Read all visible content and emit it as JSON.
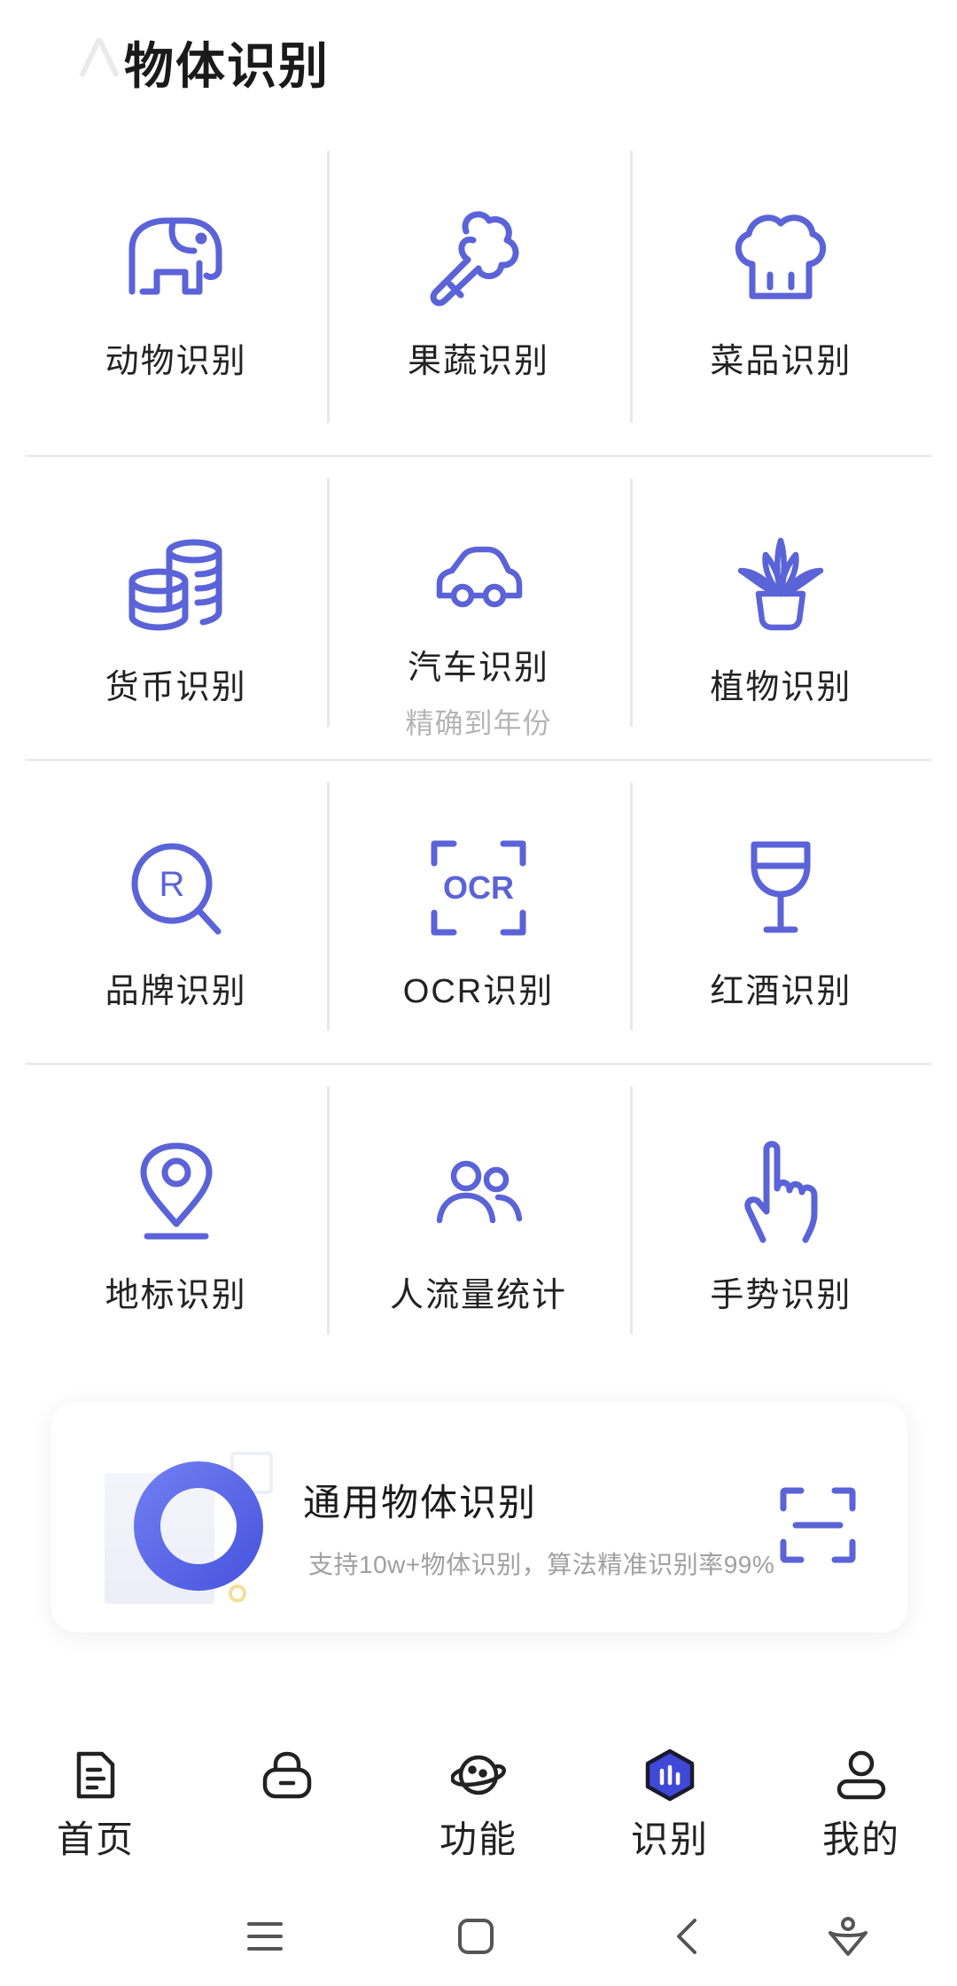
{
  "header": {
    "title": "物体识别"
  },
  "grid": {
    "rows": [
      [
        {
          "label": "动物识别",
          "icon": "elephant-icon"
        },
        {
          "label": "果蔬识别",
          "icon": "vegetable-icon"
        },
        {
          "label": "菜品识别",
          "icon": "chef-hat-icon"
        }
      ],
      [
        {
          "label": "货币识别",
          "icon": "coins-icon"
        },
        {
          "label": "汽车识别",
          "sub": "精确到年份",
          "icon": "car-icon"
        },
        {
          "label": "植物识别",
          "icon": "potted-plant-icon"
        }
      ],
      [
        {
          "label": "品牌识别",
          "icon": "brand-search-icon"
        },
        {
          "label": "OCR识别",
          "icon": "ocr-icon"
        },
        {
          "label": "红酒识别",
          "icon": "wine-glass-icon"
        }
      ],
      [
        {
          "label": "地标识别",
          "icon": "map-pin-icon"
        },
        {
          "label": "人流量统计",
          "icon": "people-icon"
        },
        {
          "label": "手势识别",
          "icon": "hand-pointer-icon"
        }
      ]
    ]
  },
  "general_card": {
    "title": "通用物体识别",
    "subtitle": "支持10w+物体识别，算法精准识别率99%"
  },
  "tabbar": {
    "tabs": [
      {
        "label": "首页",
        "icon": "document-icon"
      },
      {
        "label": "",
        "icon": "lock-icon"
      },
      {
        "label": "功能",
        "icon": "planet-icon"
      },
      {
        "label": "识别",
        "icon": "hexagon-chart-icon",
        "active": true
      },
      {
        "label": "我的",
        "icon": "user-icon"
      }
    ]
  },
  "colors": {
    "accent": "#5b63d8",
    "text": "#222222",
    "muted": "#b5b5b5"
  }
}
